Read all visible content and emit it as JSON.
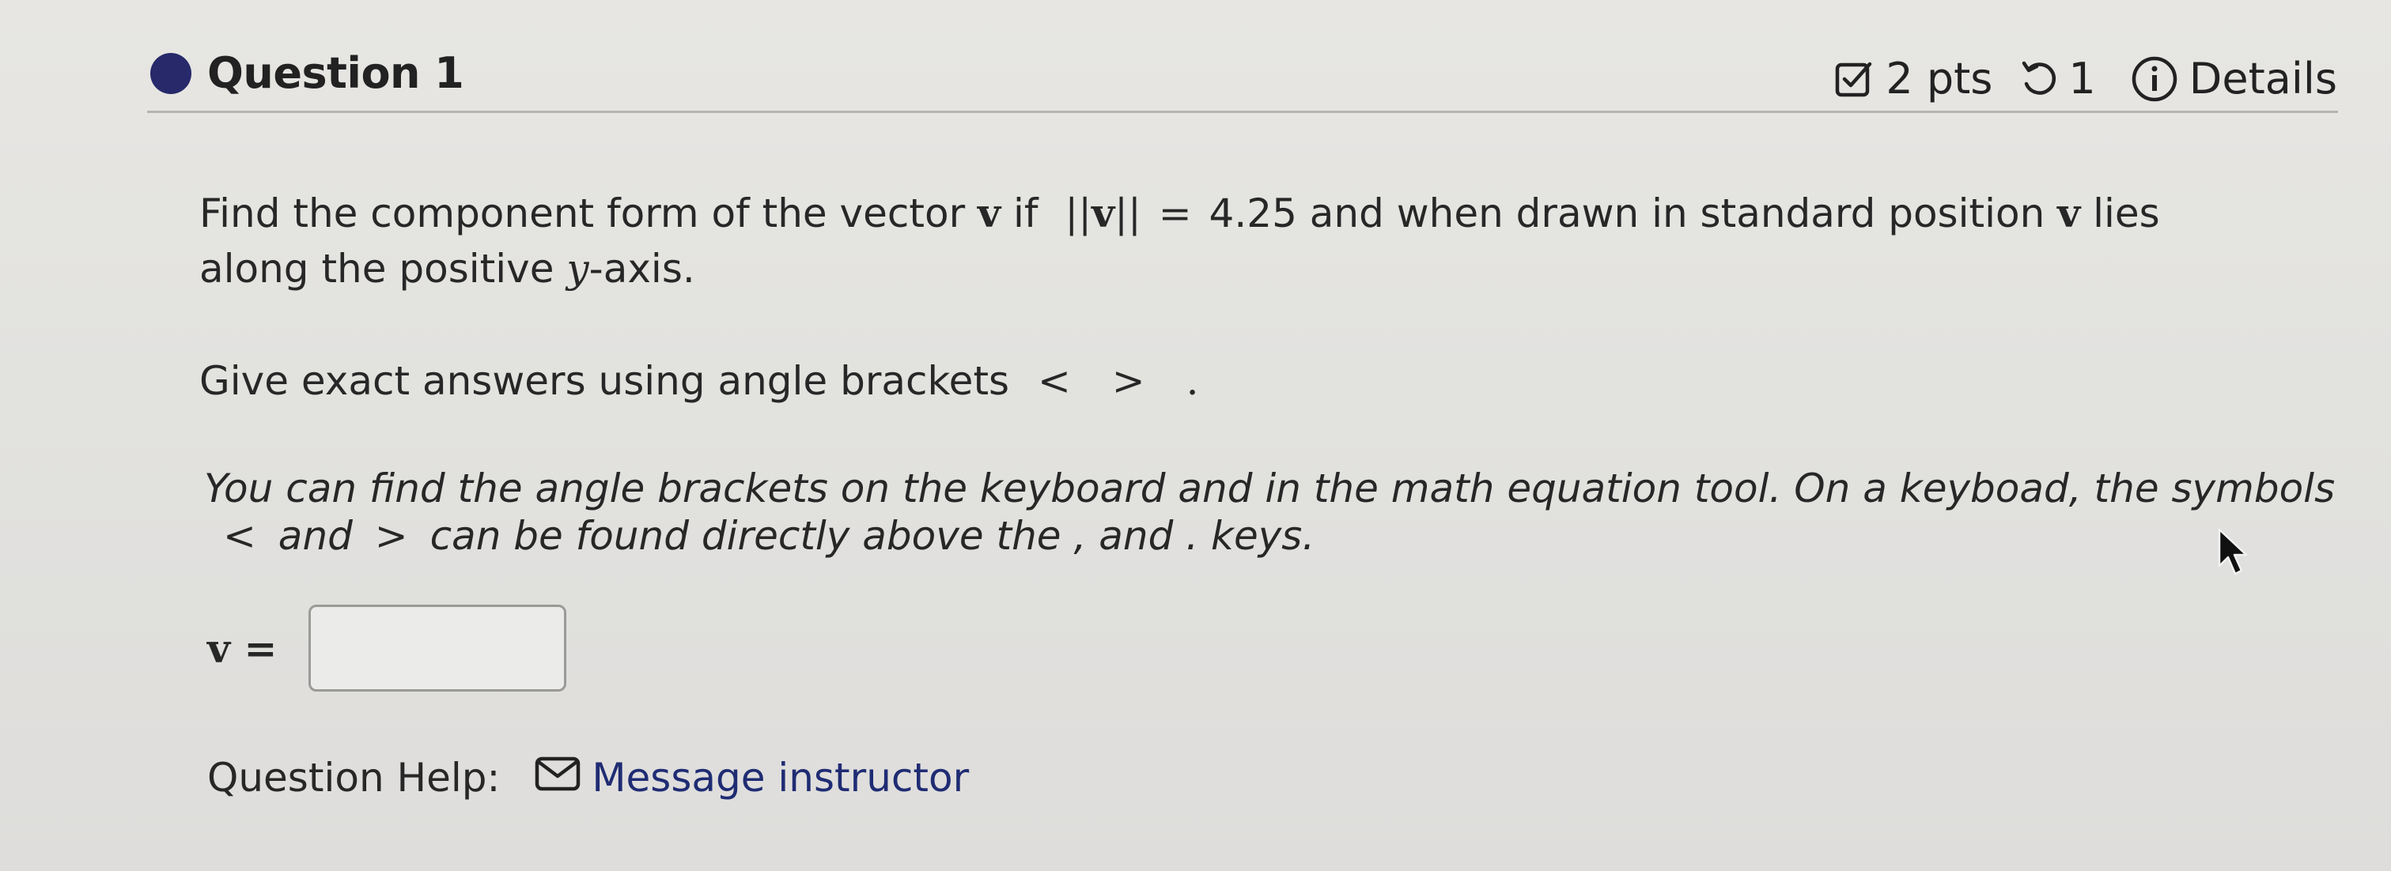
{
  "header": {
    "question_title": "Question 1",
    "points": "2 pts",
    "attempts": "1",
    "details": "Details"
  },
  "problem": {
    "line1_pre": "Find the component form of the vector ",
    "v": "v",
    "line1_if": " if ",
    "norm_open": "||",
    "norm_close": "||",
    "equals": " = ",
    "magnitude": "4.25",
    "line1_post": " and when drawn in standard position ",
    "line1_end": " lies",
    "line2_pre": "along the positive ",
    "y_var": "y",
    "line2_post": "-axis."
  },
  "instruction": {
    "text": "Give exact answers using angle brackets ",
    "brackets": "< > ."
  },
  "hint": {
    "line1": "You can find the angle brackets on the keyboard and in the math equation tool. On a keyboad, the symbols",
    "lt": "<",
    "and": " and ",
    "gt": ">",
    "line2_post": " can be found directly above the , and . keys."
  },
  "answer": {
    "label": "v =",
    "value": ""
  },
  "help": {
    "label": "Question Help:",
    "message_link": "Message instructor"
  },
  "colors": {
    "accent_dot": "#27296b",
    "link": "#1f2c73",
    "background": "#e3e3e0"
  },
  "icons": {
    "points": "checkbox-pencil-icon",
    "attempts": "retry-icon",
    "details": "info-circle-icon",
    "message": "envelope-icon",
    "cursor": "mouse-pointer-icon"
  }
}
